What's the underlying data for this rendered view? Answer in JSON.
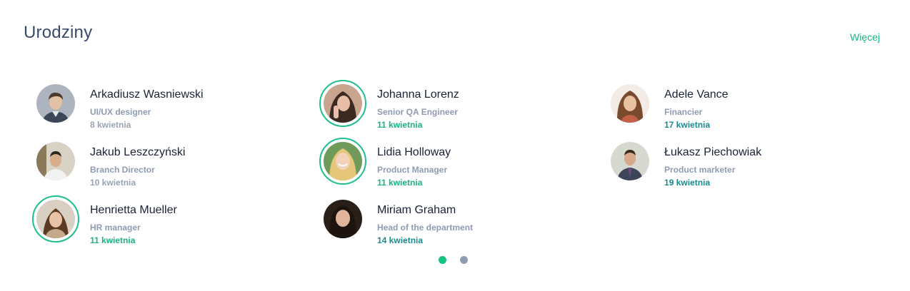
{
  "widget": {
    "title": "Urodziny",
    "more_label": "Więcej"
  },
  "columns": [
    [
      {
        "name": "Arkadiusz Wasniewski",
        "role": "UI/UX designer",
        "date": "8 kwietnia",
        "status": "past",
        "highlighted": false
      },
      {
        "name": "Jakub Leszczyński",
        "role": "Branch Director",
        "date": "10 kwietnia",
        "status": "past",
        "highlighted": false
      },
      {
        "name": "Henrietta Mueller",
        "role": "HR manager",
        "date": "11 kwietnia",
        "status": "today",
        "highlighted": true
      }
    ],
    [
      {
        "name": "Johanna Lorenz",
        "role": "Senior QA Engineer",
        "date": "11 kwietnia",
        "status": "today",
        "highlighted": true
      },
      {
        "name": "Lidia Holloway",
        "role": "Product Manager",
        "date": "11 kwietnia",
        "status": "today",
        "highlighted": true
      },
      {
        "name": "Miriam Graham",
        "role": "Head of the department",
        "date": "14 kwietnia",
        "status": "upcoming",
        "highlighted": false
      }
    ],
    [
      {
        "name": "Adele Vance",
        "role": "Financier",
        "date": "17 kwietnia",
        "status": "upcoming",
        "highlighted": false
      },
      {
        "name": "Łukasz Piechowiak",
        "role": "Product marketer",
        "date": "19 kwietnia",
        "status": "upcoming",
        "highlighted": false
      }
    ]
  ],
  "pagination": {
    "pages": 2,
    "active": 0
  },
  "colors": {
    "accent": "#17b57f",
    "ring": "#1fbf8c",
    "upcoming_date": "#1a8a8c",
    "muted": "#8f9bb3"
  }
}
